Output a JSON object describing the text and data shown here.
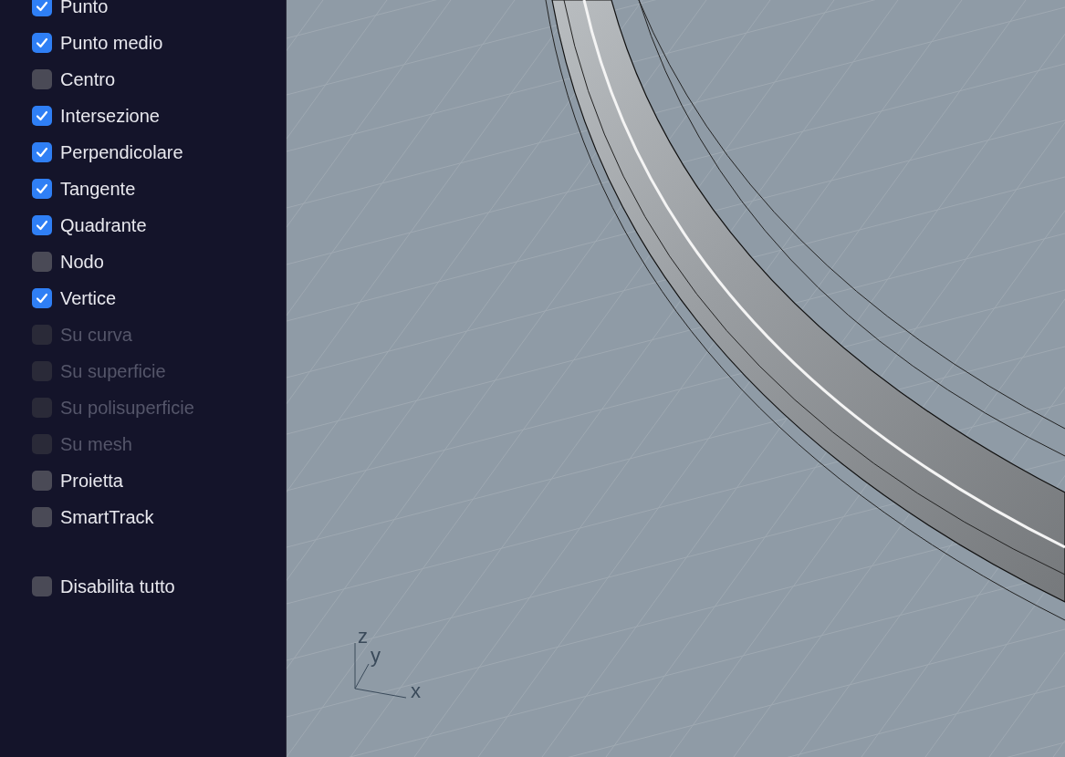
{
  "snap_panel": {
    "options": [
      {
        "label": "Punto",
        "checked": true,
        "disabled": false
      },
      {
        "label": "Punto medio",
        "checked": true,
        "disabled": false
      },
      {
        "label": "Centro",
        "checked": false,
        "disabled": false
      },
      {
        "label": "Intersezione",
        "checked": true,
        "disabled": false
      },
      {
        "label": "Perpendicolare",
        "checked": true,
        "disabled": false
      },
      {
        "label": "Tangente",
        "checked": true,
        "disabled": false
      },
      {
        "label": "Quadrante",
        "checked": true,
        "disabled": false
      },
      {
        "label": "Nodo",
        "checked": false,
        "disabled": false
      },
      {
        "label": "Vertice",
        "checked": true,
        "disabled": false
      },
      {
        "label": "Su curva",
        "checked": false,
        "disabled": true
      },
      {
        "label": "Su superficie",
        "checked": false,
        "disabled": true
      },
      {
        "label": "Su polisuperficie",
        "checked": false,
        "disabled": true
      },
      {
        "label": "Su mesh",
        "checked": false,
        "disabled": true
      },
      {
        "label": "Proietta",
        "checked": false,
        "disabled": false
      },
      {
        "label": "SmartTrack",
        "checked": false,
        "disabled": false
      }
    ],
    "disable_all": {
      "label": "Disabilita tutto",
      "checked": false,
      "disabled": false
    }
  },
  "viewport": {
    "axis_labels": [
      "z",
      "y",
      "x"
    ]
  }
}
